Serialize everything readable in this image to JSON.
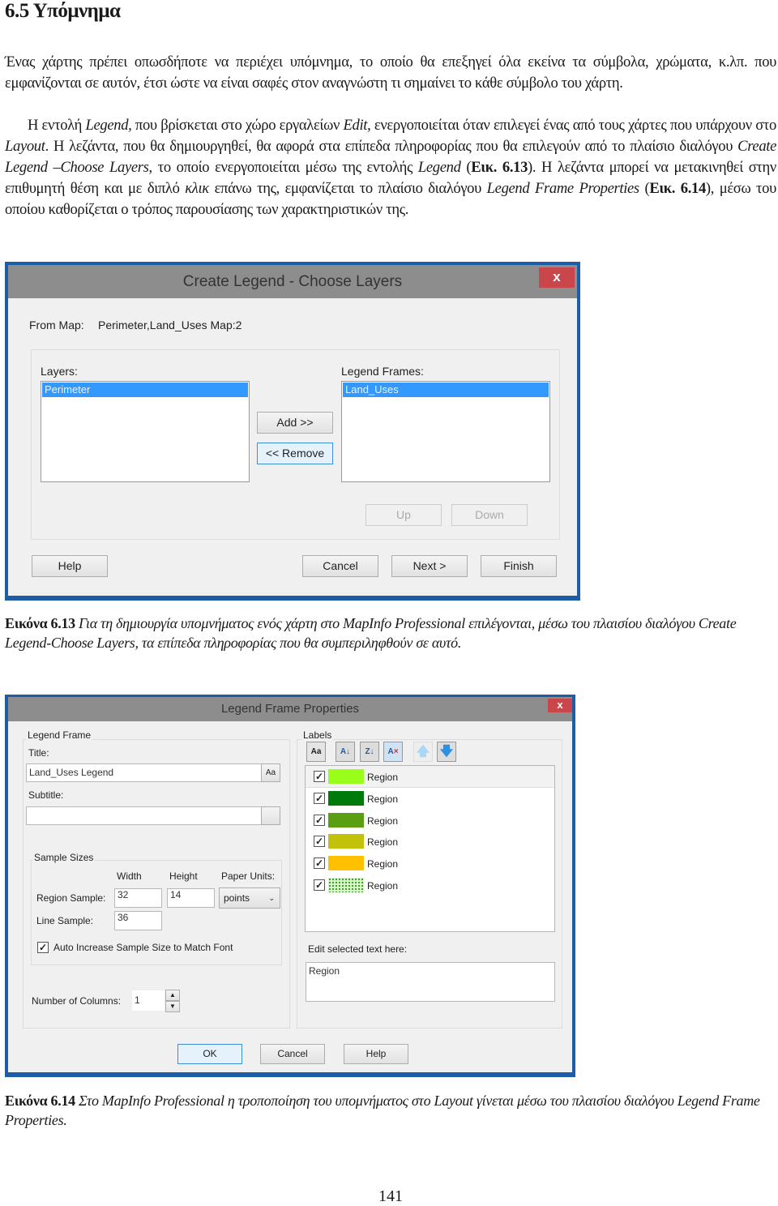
{
  "heading": "6.5 Υπόμνημα",
  "intro": {
    "p1": [
      {
        "t": "Ένας χάρτης πρέπει οπωσδήποτε να περιέχει υπόμνημα, το οποίο θα επεξηγεί όλα εκείνα τα σύμβολα, χρώματα, κ.λπ. που εμφανίζονται σε αυτόν, έτσι ώστε να είναι σαφές στον αναγνώστη τι σημαίνει το κάθε σύμβολο του χάρτη.",
        "s": ""
      }
    ],
    "p2": [
      {
        "t": "Η εντολή ",
        "s": ""
      },
      {
        "t": "Legend,",
        "s": "it"
      },
      {
        "t": " που βρίσκεται στο χώρο εργαλείων ",
        "s": ""
      },
      {
        "t": "Edit",
        "s": "it"
      },
      {
        "t": ", ενεργοποιείται όταν επιλεγεί ένας από τους χάρτες που υπάρχουν στο ",
        "s": ""
      },
      {
        "t": "Layout",
        "s": "it"
      },
      {
        "t": ". Η λεζάντα, που θα δημιουργηθεί, θα αφορά στα επίπεδα πληροφορίας που θα επιλεγούν από το πλαίσιο διαλόγου ",
        "s": ""
      },
      {
        "t": "Create Legend –Choose Layers",
        "s": "it"
      },
      {
        "t": ", το οποίο ενεργοποιείται μέσω της εντολής ",
        "s": ""
      },
      {
        "t": "Legend",
        "s": "it"
      },
      {
        "t": " (",
        "s": ""
      },
      {
        "t": "Εικ. 6.13",
        "s": "b"
      },
      {
        "t": "). Η λεζάντα μπορεί να μετακινηθεί στην επιθυμητή θέση και με διπλό ",
        "s": ""
      },
      {
        "t": "κλικ",
        "s": "it"
      },
      {
        "t": " επάνω της, εμφανίζεται το πλαίσιο διαλόγου ",
        "s": ""
      },
      {
        "t": "Legend Frame Properties",
        "s": "it"
      },
      {
        "t": " (",
        "s": ""
      },
      {
        "t": "Εικ. 6.14",
        "s": "b"
      },
      {
        "t": "), μέσω του οποίου καθορίζεται ο τρόπος παρουσίασης των χαρακτηριστικών της.",
        "s": ""
      }
    ]
  },
  "dialog1": {
    "title": "Create Legend - Choose Layers",
    "close": "x",
    "from_map_label": "From Map:",
    "from_map_value": "Perimeter,Land_Uses Map:2",
    "layers_label": "Layers:",
    "layers": [
      "Perimeter"
    ],
    "frames_label": "Legend Frames:",
    "frames": [
      "Land_Uses"
    ],
    "add": "Add >>",
    "remove": "<< Remove",
    "up": "Up",
    "down": "Down",
    "help": "Help",
    "cancel": "Cancel",
    "next": "Next >",
    "finish": "Finish"
  },
  "caption1": [
    {
      "t": "Εικόνα 6.13",
      "s": "b"
    },
    {
      "t": " Για τη δημιουργία υπομνήματος ενός χάρτη στο MapInfo Professional επιλέγονται, μέσω του πλαισίου διαλόγου Create Legend-Choose Layers, τα επίπεδα πληροφορίας που θα συμπεριληφθούν σε αυτό.",
      "s": "it"
    }
  ],
  "dialog2": {
    "title": "Legend Frame Properties",
    "close": "x",
    "frame_group": "Legend Frame",
    "title_label": "Title:",
    "title_value": "Land_Uses Legend",
    "font_btn": "Aa",
    "subtitle_label": "Subtitle:",
    "subtitle_value": "",
    "sample_group": "Sample Sizes",
    "width_label": "Width",
    "height_label": "Height",
    "units_label": "Paper Units:",
    "region_sample_label": "Region Sample:",
    "region_width": "32",
    "region_height": "14",
    "units_value": "points",
    "line_sample_label": "Line Sample:",
    "line_width": "36",
    "auto_increase_label": "Auto Increase Sample Size to Match Font",
    "auto_increase_checked": true,
    "columns_label": "Number of Columns:",
    "columns_value": "1",
    "labels_group": "Labels",
    "labels_font_btn": "Aa",
    "labels": [
      {
        "text": "Region",
        "checked": true,
        "color": "#99ff1a"
      },
      {
        "text": "Region",
        "checked": true,
        "color": "#007a0a"
      },
      {
        "text": "Region",
        "checked": true,
        "color": "#5a9e12"
      },
      {
        "text": "Region",
        "checked": true,
        "color": "#c2c20a"
      },
      {
        "text": "Region",
        "checked": true,
        "color": "#ffc000"
      },
      {
        "text": "Region",
        "checked": true,
        "color": "pattern-dots-green"
      }
    ],
    "edit_label": "Edit selected text here:",
    "edit_value": "Region",
    "ok": "OK",
    "cancel": "Cancel",
    "help": "Help"
  },
  "caption2": [
    {
      "t": "Εικόνα 6.14",
      "s": "b"
    },
    {
      "t": " Στο MapInfo Professional η τροποποίηση του υπομνήματος στο Layout γίνεται μέσω του πλαισίου διαλόγου Legend Frame Properties.",
      "s": "it"
    }
  ],
  "page_number": "141"
}
